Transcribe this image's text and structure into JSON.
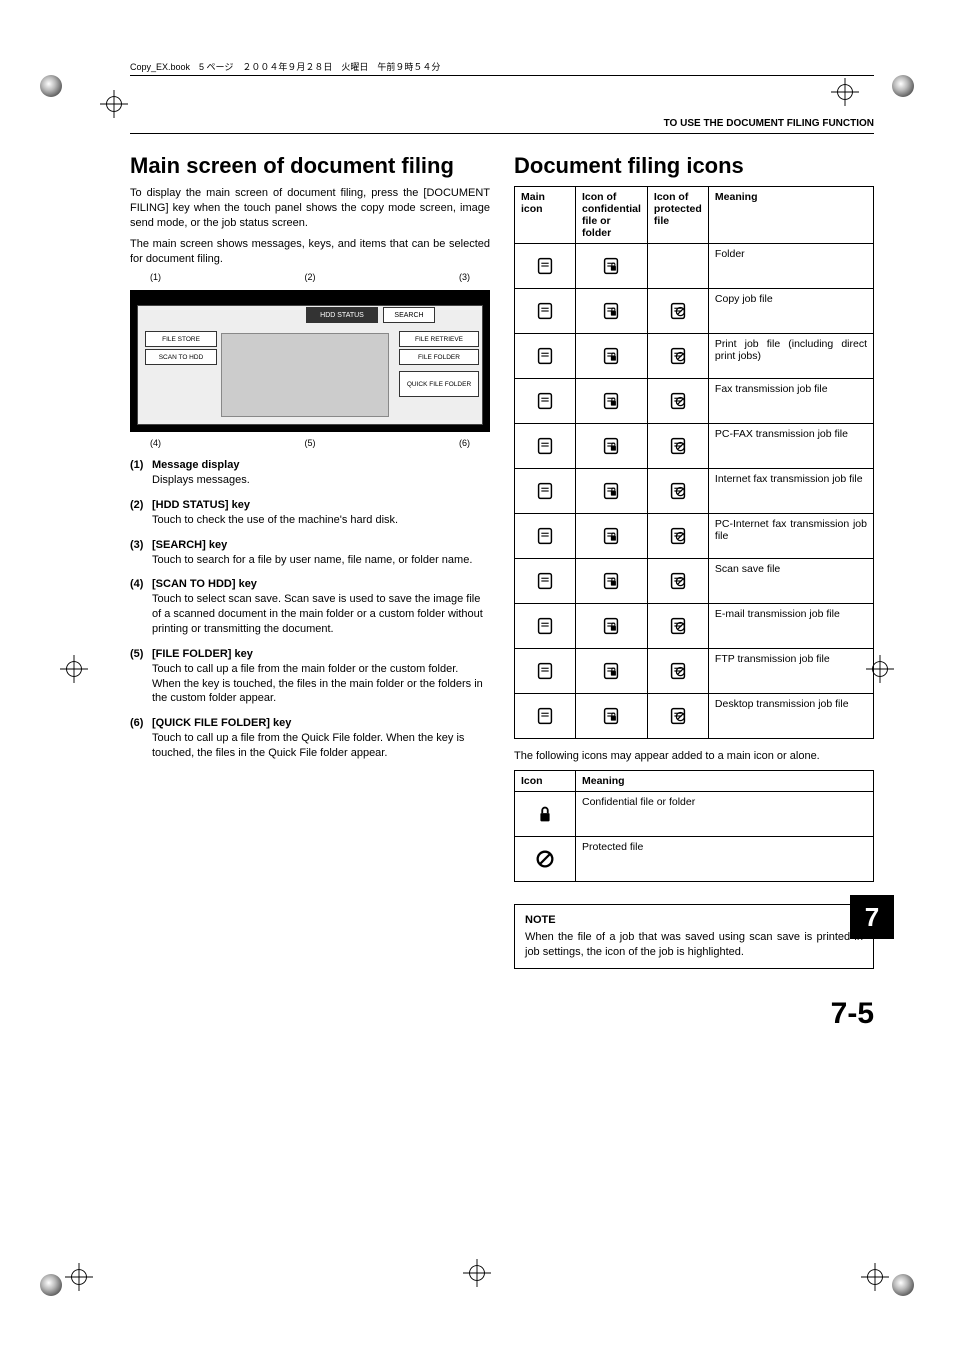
{
  "header": {
    "book_info": "Copy_EX.book　5 ページ　２００４年９月２８日　火曜日　午前９時５４分",
    "running_head": "TO USE THE DOCUMENT FILING FUNCTION"
  },
  "left": {
    "title": "Main screen of document filing",
    "intro1": "To display the main screen of document filing, press the [DOCUMENT FILING] key when the touch panel shows the copy mode screen, image send mode, or the job status screen.",
    "intro2": "The main screen shows messages, keys, and items that can be selected for document filing.",
    "diagram_buttons": {
      "file_store": "FILE STORE",
      "scan_to_hdd": "SCAN TO HDD",
      "hdd_status": "HDD STATUS",
      "search": "SEARCH",
      "file_retrieve": "FILE RETRIEVE",
      "file_folder": "FILE FOLDER",
      "quick_file_folder": "QUICK FILE FOLDER"
    },
    "callout_top": {
      "c1": "(1)",
      "c2": "(2)",
      "c3": "(3)"
    },
    "callout_bottom": {
      "c4": "(4)",
      "c5": "(5)",
      "c6": "(6)"
    },
    "keys": [
      {
        "title": "Message display",
        "body": "Displays messages."
      },
      {
        "title": "[HDD STATUS] key",
        "body": "Touch to check the use of the machine's hard disk."
      },
      {
        "title": "[SEARCH] key",
        "body": "Touch to search for a file by user name, file name, or folder name."
      },
      {
        "title": "[SCAN TO HDD] key",
        "body": "Touch to select scan save. Scan save is used to save the image file of a scanned document in the main folder or a custom folder without printing or transmitting the document."
      },
      {
        "title": "[FILE FOLDER] key",
        "body": "Touch to call up a file from the main folder or the custom folder. When the key is touched, the files in the main folder or the folders in the custom folder appear."
      },
      {
        "title": "[QUICK FILE FOLDER] key",
        "body": "Touch to call up a file from the Quick File folder. When the key is touched, the files in the Quick File folder appear."
      }
    ]
  },
  "right": {
    "title": "Document filing icons",
    "table_headers": {
      "h1": "Main icon",
      "h2": "Icon of confidential file or folder",
      "h3": "Icon of protected file",
      "h4": "Meaning"
    },
    "rows": [
      {
        "m": "Folder",
        "p": false
      },
      {
        "m": "Copy job file",
        "p": true
      },
      {
        "m": "Print job file (including direct print jobs)",
        "p": true
      },
      {
        "m": "Fax transmission job file",
        "p": true
      },
      {
        "m": "PC-FAX transmission job file",
        "p": true
      },
      {
        "m": "Internet fax transmission job file",
        "p": true
      },
      {
        "m": "PC-Internet fax transmission job file",
        "p": true
      },
      {
        "m": "Scan save file",
        "p": true
      },
      {
        "m": "E-mail transmission job file",
        "p": true
      },
      {
        "m": "FTP transmission job file",
        "p": true
      },
      {
        "m": "Desktop transmission job file",
        "p": true
      }
    ],
    "after_table": "The following icons may appear added to a main icon or alone.",
    "small_table_headers": {
      "h1": "Icon",
      "h2": "Meaning"
    },
    "small_rows": [
      {
        "m": "Confidential file or folder",
        "icon": "lock"
      },
      {
        "m": "Protected file",
        "icon": "nosign"
      }
    ],
    "note": {
      "title": "NOTE",
      "body": "When the file of a job that was saved using scan save is printed in job settings, the icon of the job is highlighted."
    }
  },
  "page_number": "7-5",
  "chapter_tab": "7"
}
